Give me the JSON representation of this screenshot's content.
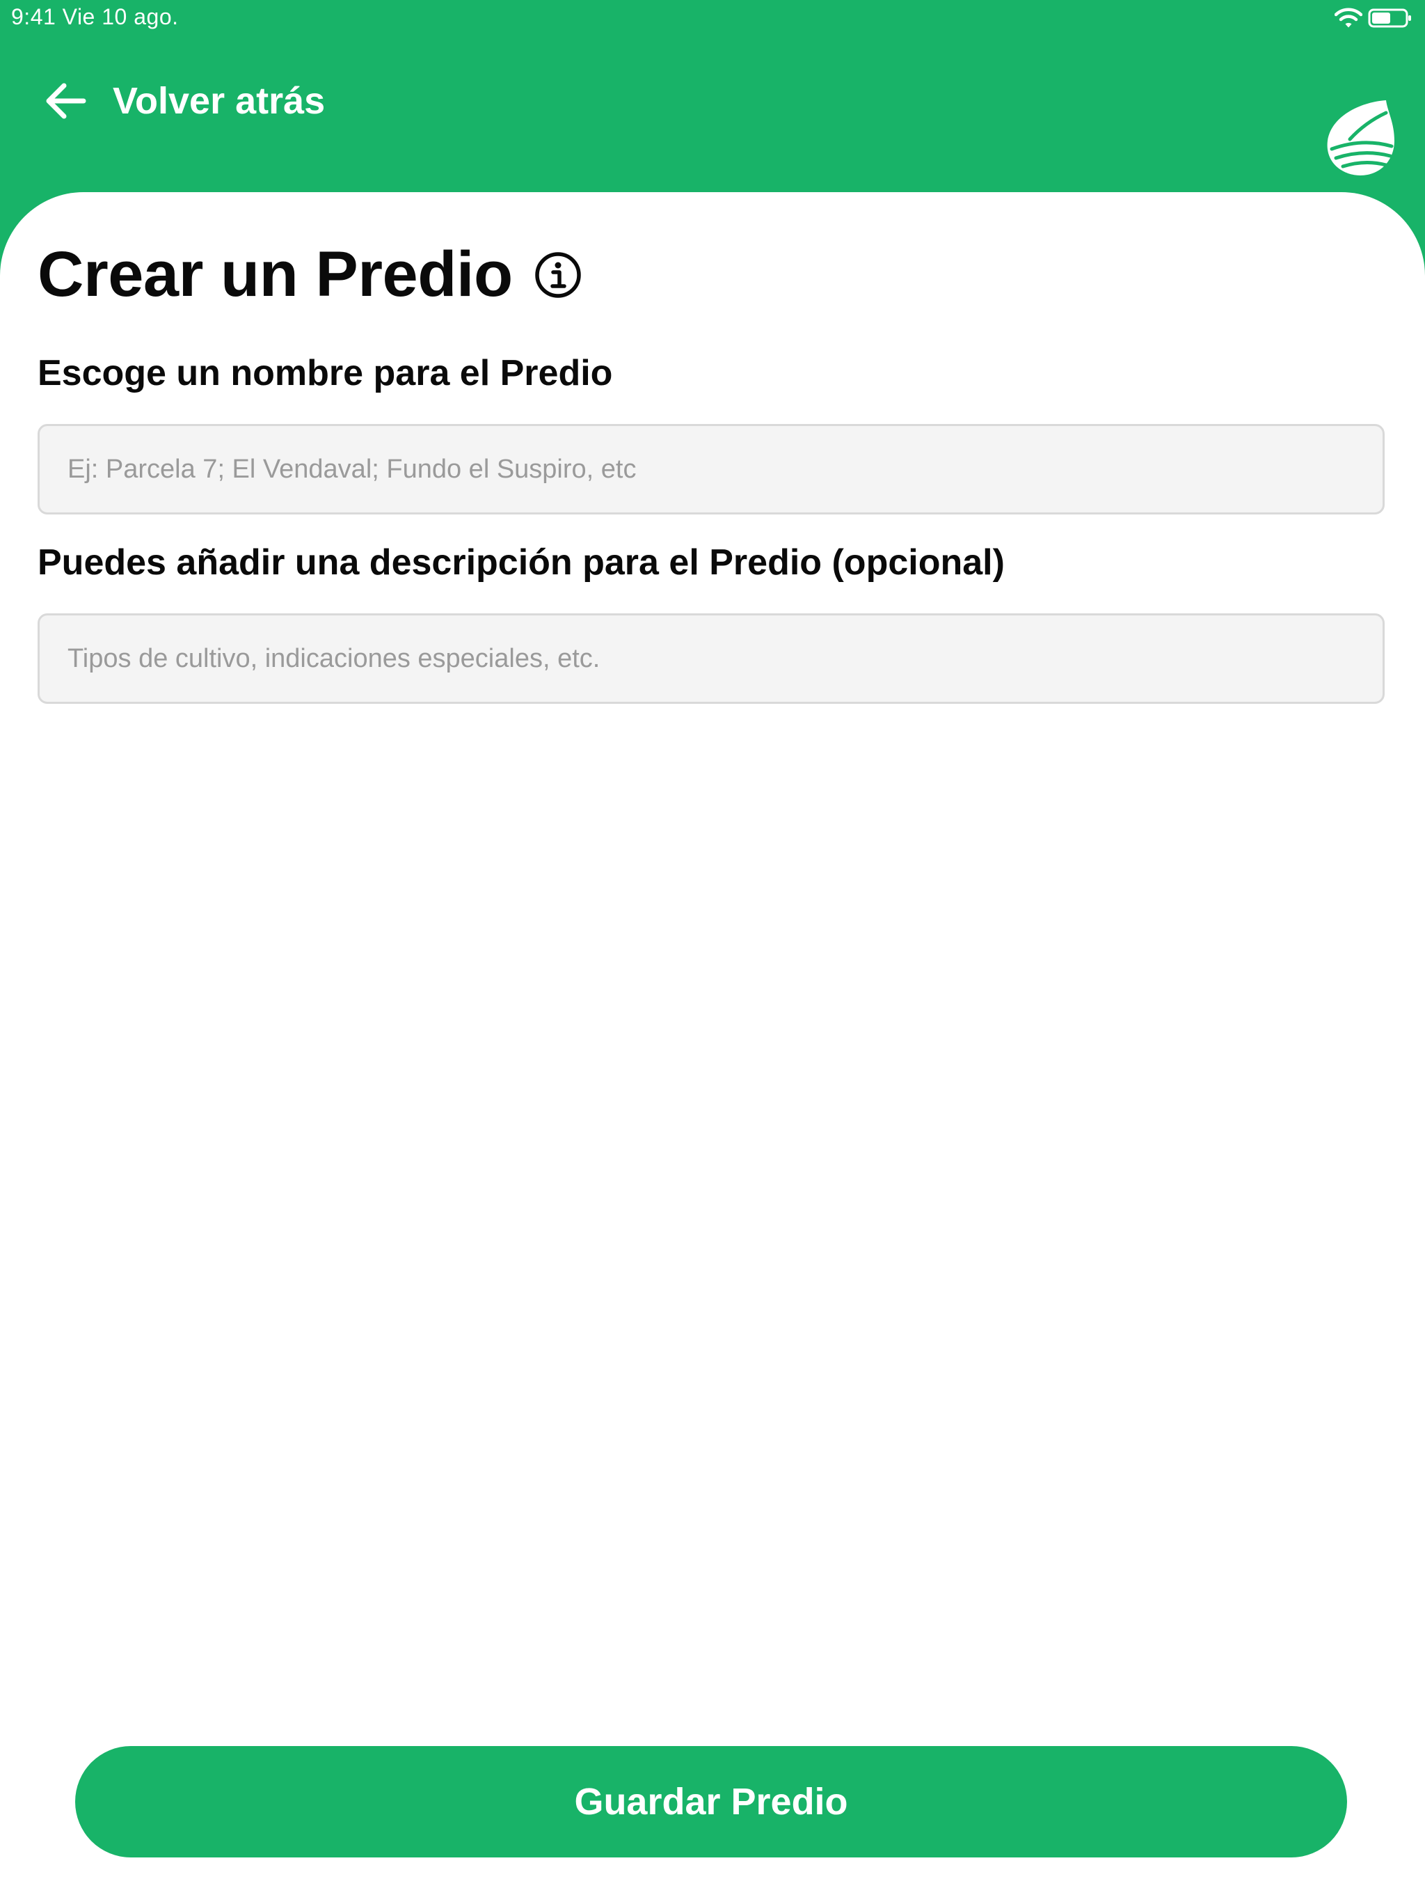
{
  "status_bar": {
    "time_date": "9:41  Vie 10 ago.",
    "wifi_icon": "wifi-icon",
    "battery_icon": "battery-icon"
  },
  "header": {
    "back_label": "Volver atrás",
    "back_icon": "arrow-left-icon",
    "logo": "leaf-field-logo"
  },
  "form": {
    "title": "Crear un Predio",
    "info_icon": "info-icon",
    "name_label": "Escoge un nombre para el Predio",
    "name_placeholder": "Ej: Parcela 7; El Vendaval; Fundo el Suspiro, etc",
    "name_value": "",
    "description_label": "Puedes añadir una descripción para el Predio (opcional)",
    "description_placeholder": "Tipos de cultivo, indicaciones especiales, etc.",
    "description_value": ""
  },
  "actions": {
    "save_label": "Guardar Predio"
  },
  "colors": {
    "brand_green": "#18b368",
    "background": "#ffffff",
    "input_background": "#f4f4f4",
    "input_border": "#d9d9d9",
    "text": "#0a0a0a",
    "placeholder": "#9a9a9a"
  }
}
